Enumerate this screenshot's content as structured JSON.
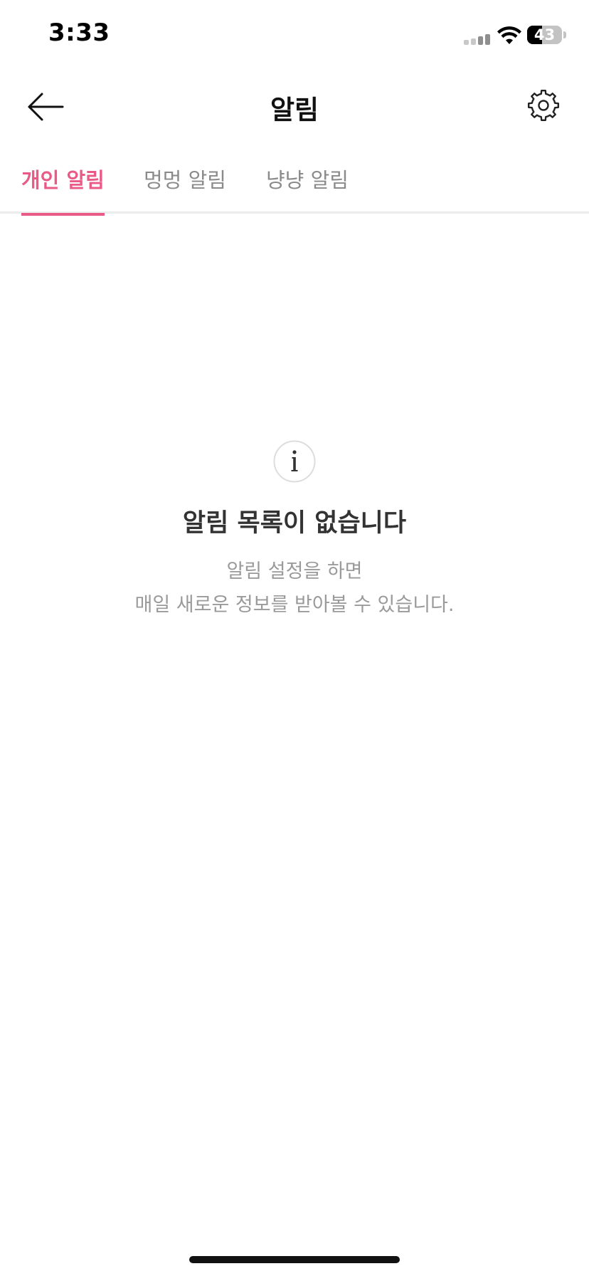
{
  "status_bar": {
    "time": "3:33",
    "battery_level": "43",
    "battery_percent": 43,
    "signal_bars_active": 2,
    "signal_bars_total": 4
  },
  "header": {
    "title": "알림",
    "back_icon": "arrow-left-icon",
    "settings_icon": "gear-icon"
  },
  "tabs": [
    {
      "label": "개인 알림",
      "active": true
    },
    {
      "label": "멍멍 알림",
      "active": false
    },
    {
      "label": "냥냥 알림",
      "active": false
    }
  ],
  "empty_state": {
    "icon": "info-icon",
    "title": "알림 목록이 없습니다",
    "description_line1": "알림 설정을 하면",
    "description_line2": "매일 새로운 정보를 받아볼 수 있습니다."
  },
  "colors": {
    "accent": "#e95a86",
    "inactive_tab": "#8a8a8a",
    "muted_text": "#9a9a9a"
  }
}
